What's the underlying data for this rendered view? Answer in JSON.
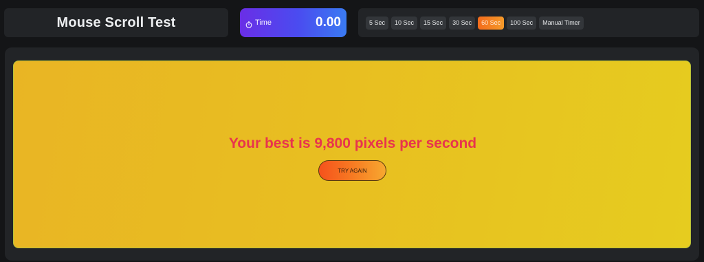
{
  "header": {
    "title": "Mouse Scroll Test"
  },
  "timer_display": {
    "icon": "stopwatch-icon",
    "label": "Time",
    "value": "0.00"
  },
  "timer_options": {
    "options": [
      "5 Sec",
      "10 Sec",
      "15 Sec",
      "30 Sec",
      "60 Sec",
      "100 Sec",
      "Manual Timer"
    ],
    "selected": "60 Sec"
  },
  "result": {
    "message": "Your best is 9,800 pixels per second",
    "try_again_label": "TRY AGAIN"
  },
  "colors": {
    "background": "#141517",
    "panel": "#222427",
    "play_area": "#e8be21",
    "result_text": "#e8344d",
    "active_option": "#f36b1c",
    "time_gradient_start": "#6a2ee6",
    "time_gradient_end": "#3a7bf2"
  }
}
